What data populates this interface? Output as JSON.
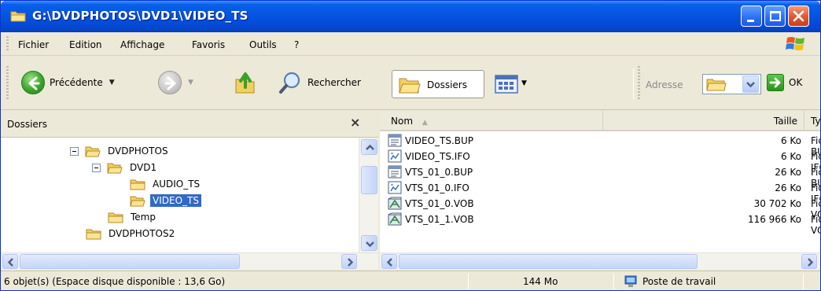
{
  "window": {
    "title": "G:\\DVDPHOTOS\\DVD1\\VIDEO_TS"
  },
  "menubar": {
    "items": [
      "Fichier",
      "Edition",
      "Affichage",
      "Favoris",
      "Outils",
      "?"
    ]
  },
  "toolbar": {
    "back_label": "Précédente",
    "search_label": "Rechercher",
    "folders_label": "Dossiers",
    "address_label": "Adresse",
    "ok_label": "OK"
  },
  "folders_pane": {
    "title": "Dossiers",
    "close_glyph": "×",
    "tree": [
      {
        "label": "DVDPHOTOS",
        "expanded": true
      },
      {
        "label": "DVD1",
        "expanded": true
      },
      {
        "label": "AUDIO_TS"
      },
      {
        "label": "VIDEO_TS",
        "selected": true
      },
      {
        "label": "Temp"
      },
      {
        "label": "DVDPHOTOS2"
      }
    ]
  },
  "file_list": {
    "columns": [
      "Nom",
      "Taille",
      "Type"
    ],
    "rows": [
      {
        "name": "VIDEO_TS.BUP",
        "size": "6 Ko",
        "type": "Fichier BUP",
        "icon": "bup-file-icon"
      },
      {
        "name": "VIDEO_TS.IFO",
        "size": "6 Ko",
        "type": "Fichier IFO",
        "icon": "ifo-file-icon"
      },
      {
        "name": "VTS_01_0.BUP",
        "size": "26 Ko",
        "type": "Fichier BUP",
        "icon": "bup-file-icon"
      },
      {
        "name": "VTS_01_0.IFO",
        "size": "26 Ko",
        "type": "Fichier IFO",
        "icon": "ifo-file-icon"
      },
      {
        "name": "VTS_01_0.VOB",
        "size": "30 702 Ko",
        "type": "Fichier VOB",
        "icon": "vob-file-icon"
      },
      {
        "name": "VTS_01_1.VOB",
        "size": "116 966 Ko",
        "type": "Fichier VOB",
        "icon": "vob-file-icon"
      }
    ]
  },
  "statusbar": {
    "objects": "6 objet(s) (Espace disque disponible : 13,6 Go)",
    "size": "144 Mo",
    "zone": "Poste de travail"
  },
  "colors": {
    "title_bar": "#0553e0",
    "selection": "#316ac5",
    "close_button": "#e0562c"
  }
}
